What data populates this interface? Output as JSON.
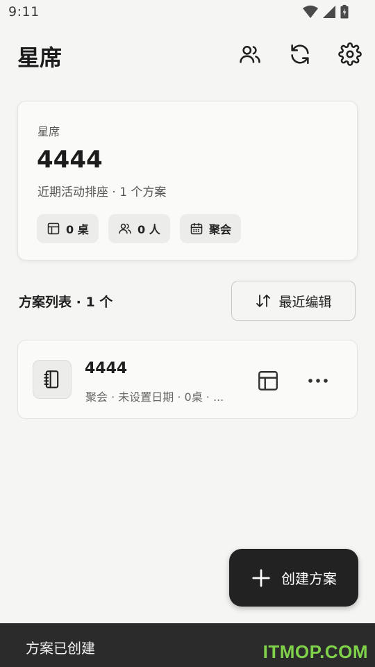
{
  "status_bar": {
    "time": "9:11",
    "icons": [
      "wifi-icon",
      "signal-icon",
      "battery-icon"
    ]
  },
  "app_bar": {
    "title": "星席",
    "actions": [
      "people-icon",
      "refresh-icon",
      "settings-icon"
    ]
  },
  "summary": {
    "overline": "星席",
    "title": "4444",
    "subtitle": "近期活动排座 · 1 个方案",
    "chips": [
      {
        "icon": "table-icon",
        "label": "0 桌"
      },
      {
        "icon": "people-icon",
        "label": "0 人"
      },
      {
        "icon": "calendar-icon",
        "label": "聚会"
      }
    ]
  },
  "list": {
    "header": "方案列表 · 1 个",
    "sort_label": "最近编辑",
    "items": [
      {
        "name": "4444",
        "meta": "聚会 · 未设置日期 · 0桌 · ..."
      }
    ]
  },
  "fab": {
    "label": "创建方案"
  },
  "snackbar": {
    "message": "方案已创建",
    "watermark": "ITMOP.COM"
  },
  "colors": {
    "background": "#f5f5f3",
    "fab": "#222222",
    "snackbar": "#2b2b2b",
    "watermark": "#7fd24a"
  }
}
